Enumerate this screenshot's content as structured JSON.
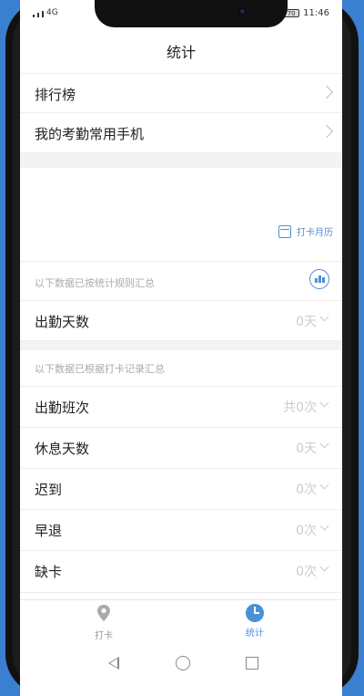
{
  "status_bar": {
    "network": "4G",
    "time": "11:46",
    "battery": "70"
  },
  "header": {
    "title": "统计"
  },
  "menu": [
    {
      "label": "排行榜"
    },
    {
      "label": "我的考勤常用手机"
    }
  ],
  "calendar_link": {
    "label": "打卡月历",
    "icon": "calendar-icon"
  },
  "section_rules": {
    "note": "以下数据已按统计规则汇总",
    "icon": "bar-chart-icon",
    "items": [
      {
        "label": "出勤天数",
        "value": "0天"
      }
    ]
  },
  "section_records": {
    "note": "以下数据已根据打卡记录汇总",
    "items": [
      {
        "label": "出勤班次",
        "value": "共0次"
      },
      {
        "label": "休息天数",
        "value": "0天"
      },
      {
        "label": "迟到",
        "value": "0次"
      },
      {
        "label": "早退",
        "value": "0次"
      },
      {
        "label": "缺卡",
        "value": "0次"
      }
    ]
  },
  "tabs": [
    {
      "label": "打卡",
      "icon": "location-pin-icon",
      "active": false
    },
    {
      "label": "统计",
      "icon": "pie-chart-icon",
      "active": true
    }
  ],
  "colors": {
    "accent": "#4a90d9",
    "background": "#3a7fd0",
    "text": "#222222",
    "muted": "#aaaaaa"
  }
}
